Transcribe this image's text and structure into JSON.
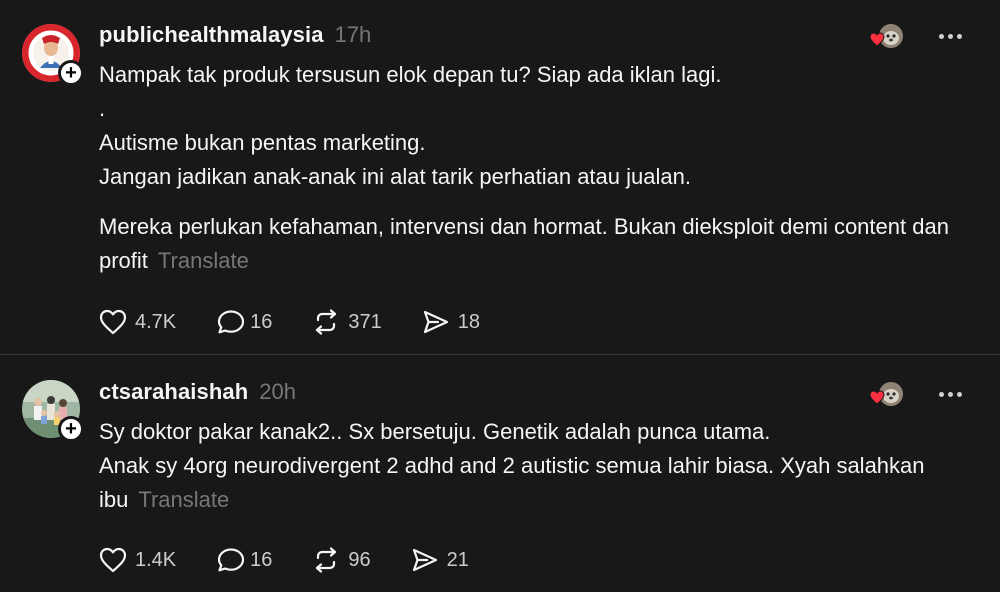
{
  "posts": [
    {
      "username": "publichealthmalaysia",
      "time": "17h",
      "avatar_icon": "health-logo-avatar",
      "paragraphs": [
        [
          "Nampak tak produk tersusun elok depan tu? Siap ada iklan lagi.",
          ".",
          "Autisme bukan pentas marketing.",
          "Jangan jadikan anak-anak ini alat tarik perhatian atau jualan."
        ],
        [
          "Mereka perlukan kefahaman, intervensi dan hormat. Bukan dieksploit demi content dan profit"
        ]
      ],
      "translate": "Translate",
      "likes": "4.7K",
      "replies": "16",
      "reposts": "371",
      "shares": "18"
    },
    {
      "username": "ctsarahaishah",
      "time": "20h",
      "avatar_icon": "family-photo-avatar",
      "paragraphs": [
        [
          "Sy doktor pakar kanak2.. Sx bersetuju. Genetik adalah punca utama.",
          "Anak sy 4org neurodivergent 2 adhd and 2 autistic semua lahir biasa. Xyah salahkan ibu"
        ]
      ],
      "translate": "Translate",
      "likes": "1.4K",
      "replies": "16",
      "reposts": "96",
      "shares": "21"
    }
  ],
  "icons": {
    "like": "heart-outline-icon",
    "reply": "speech-bubble-icon",
    "repost": "repost-arrows-icon",
    "share": "send-arrow-icon",
    "more": "more-dots-icon",
    "follow": "plus-icon"
  },
  "colors": {
    "background": "#181818",
    "text": "#f3f5f7",
    "muted": "#777777",
    "heart_badge": "#ff3040"
  }
}
